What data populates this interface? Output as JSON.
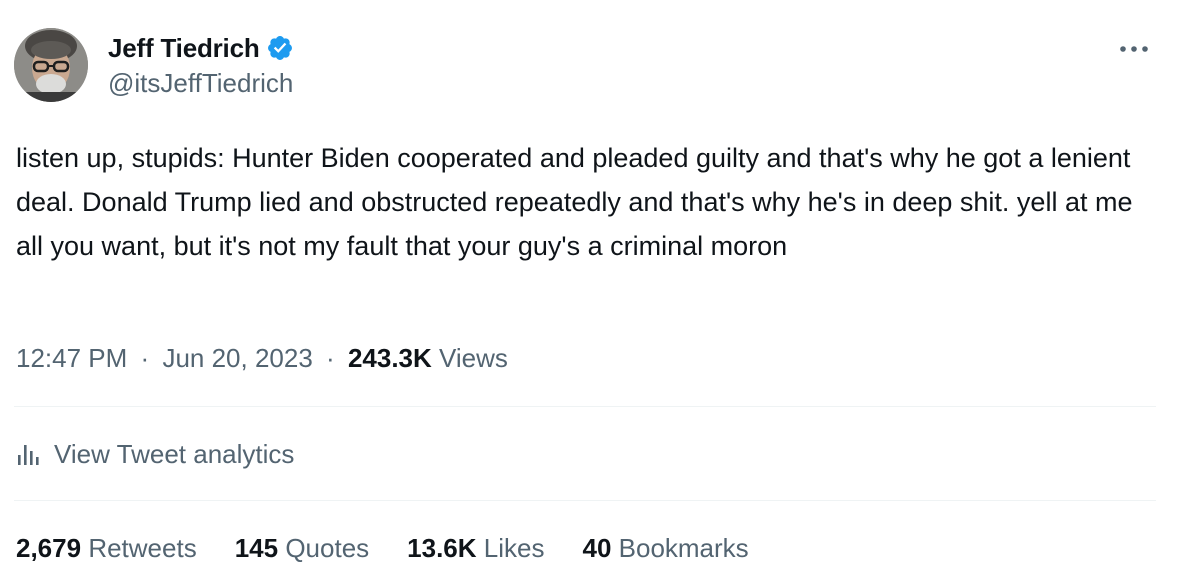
{
  "author": {
    "display_name": "Jeff Tiedrich",
    "handle": "@itsJeffTiedrich",
    "verified_icon": "verified-badge-icon",
    "verified_color": "#1d9bf0"
  },
  "tweet": {
    "text": "listen up, stupids: Hunter Biden cooperated and pleaded guilty and that's why he got a lenient deal. Donald Trump lied and obstructed repeatedly and that's why he's in deep shit. yell at me all you want, but it's not my fault that your guy's a criminal moron",
    "time": "12:47 PM",
    "separator": "·",
    "date": "Jun 20, 2023",
    "views_count": "243.3K",
    "views_label": "Views"
  },
  "analytics": {
    "icon": "analytics-bar-chart-icon",
    "label": "View Tweet analytics"
  },
  "stats": {
    "retweets": {
      "count": "2,679",
      "label": "Retweets"
    },
    "quotes": {
      "count": "145",
      "label": "Quotes"
    },
    "likes": {
      "count": "13.6K",
      "label": "Likes"
    },
    "bookmarks": {
      "count": "40",
      "label": "Bookmarks"
    }
  },
  "more_icon": "more-horizontal-icon",
  "colors": {
    "text_primary": "#0f1419",
    "text_secondary": "#536471",
    "divider": "#eff3f4",
    "accent": "#1d9bf0"
  }
}
